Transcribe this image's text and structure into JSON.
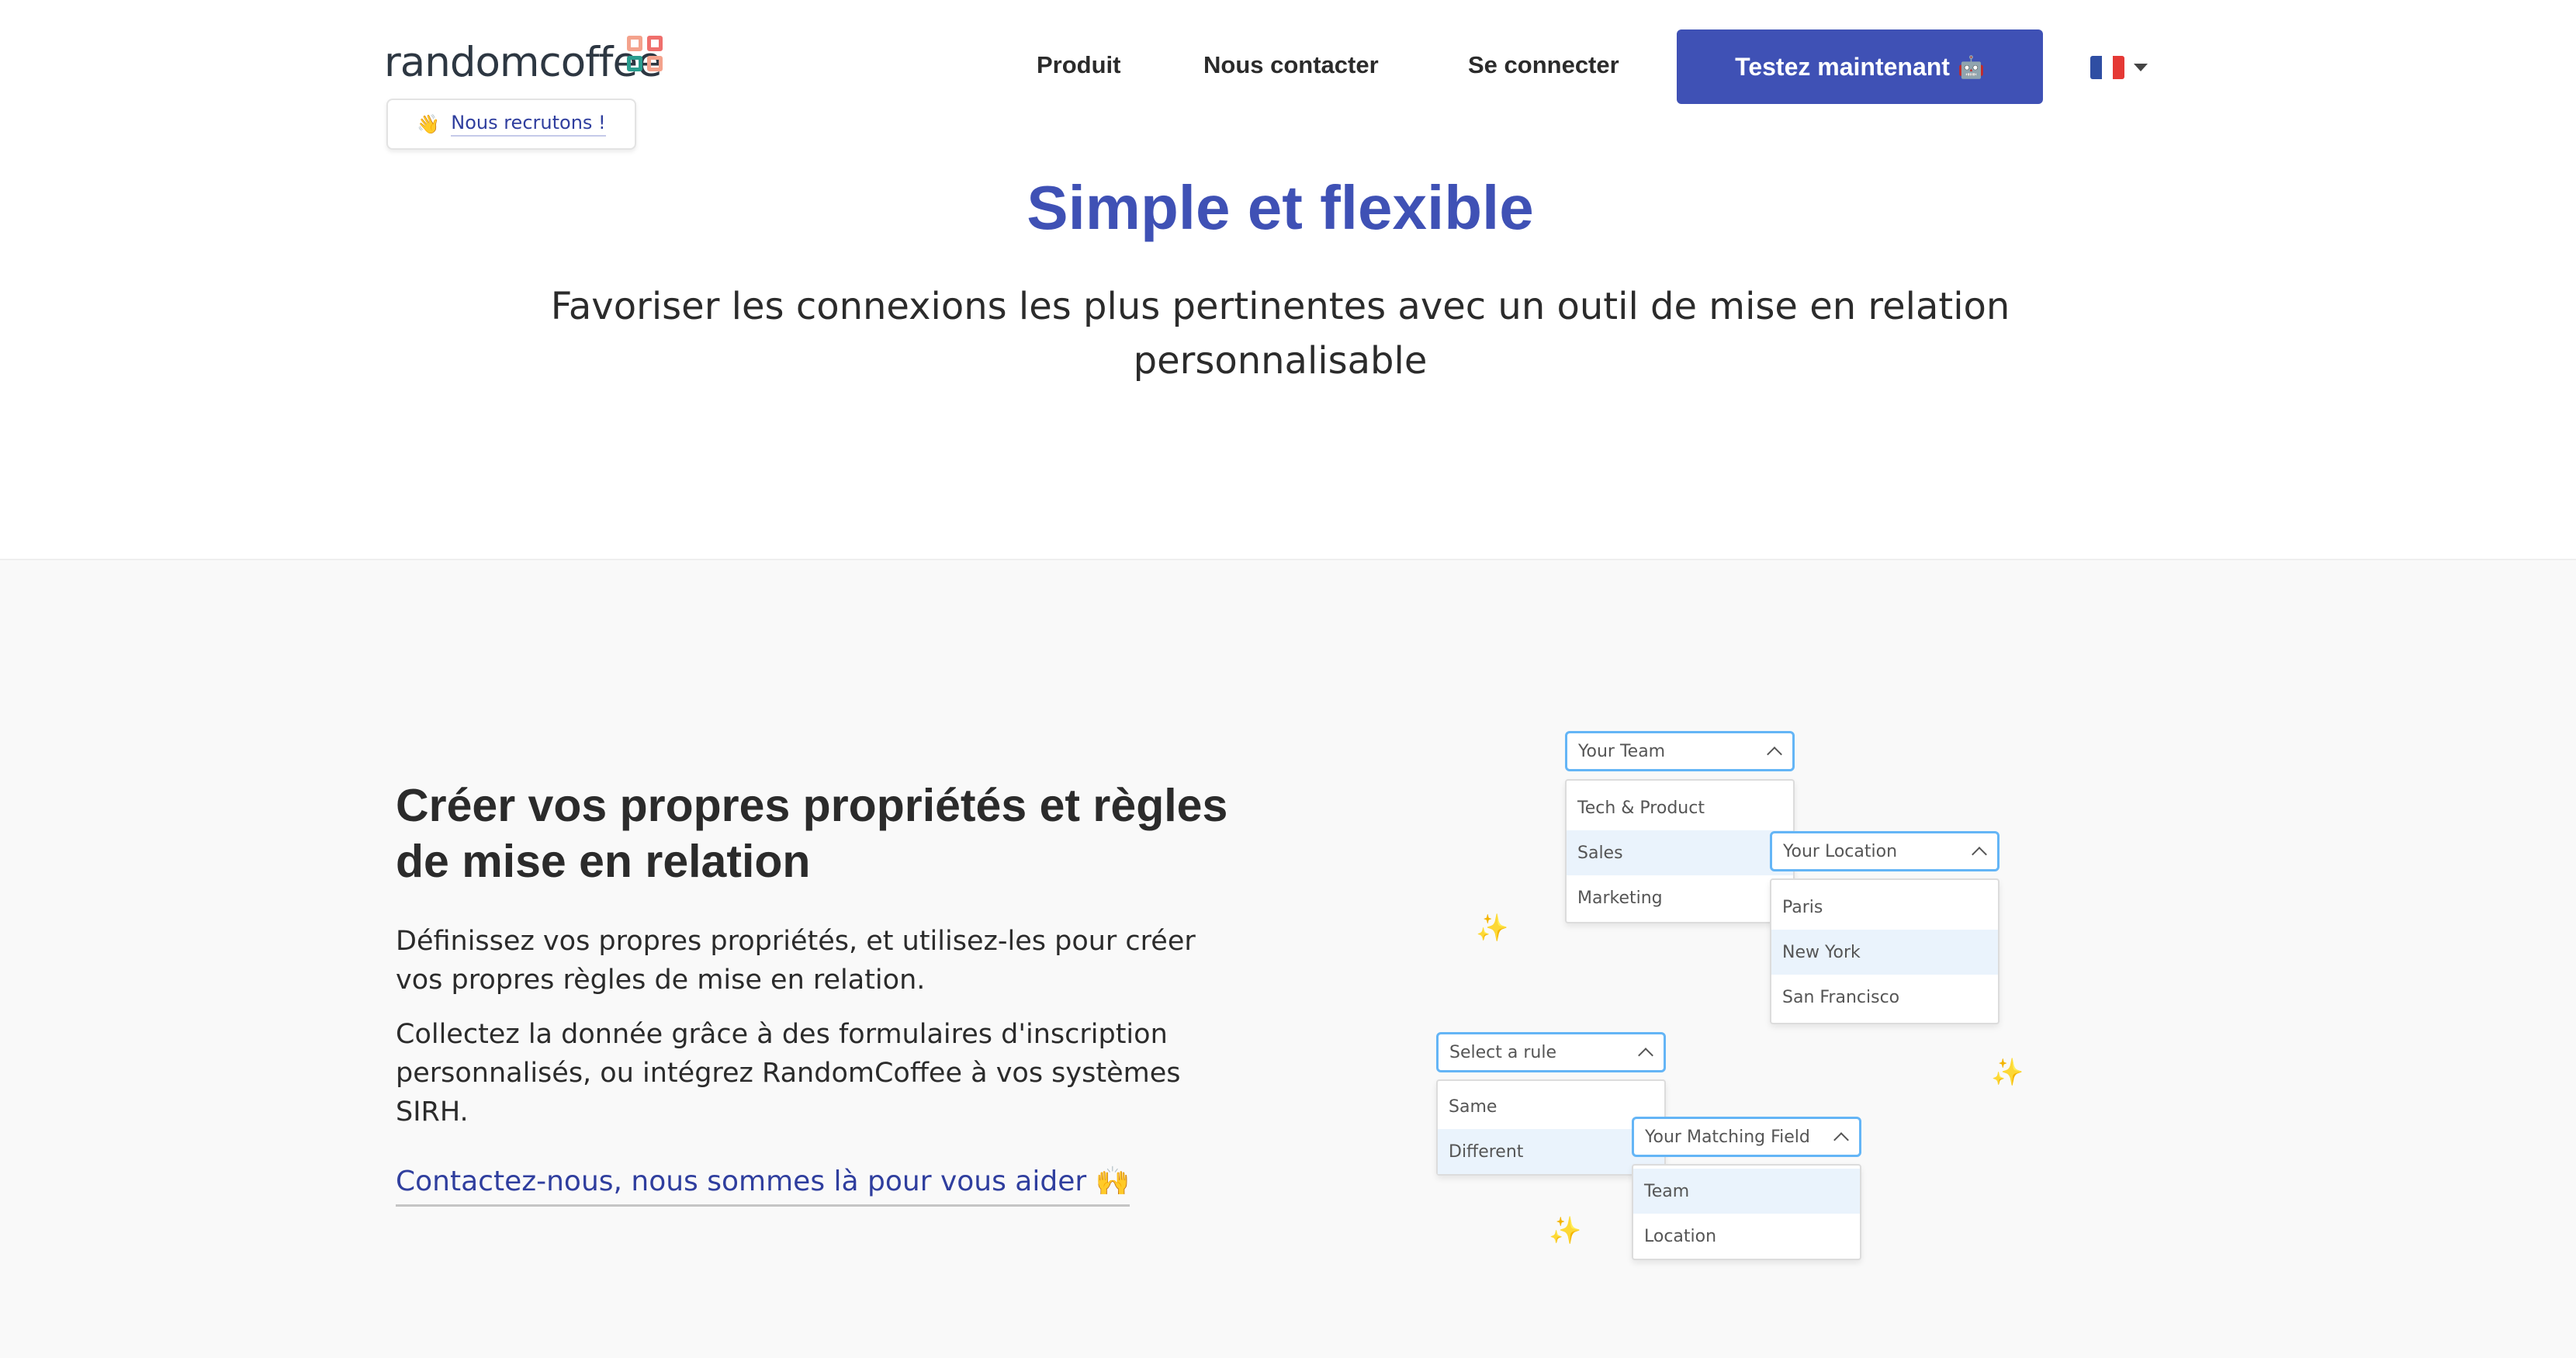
{
  "header": {
    "logo_text": "randomcoffee",
    "recruit_emoji": "👋",
    "recruit_label": "Nous recrutons !",
    "nav": [
      "Produit",
      "Nous contacter",
      "Se connecter"
    ],
    "cta_label": "Testez maintenant",
    "cta_emoji": "🤖",
    "language": "fr"
  },
  "hero": {
    "title": "Simple et flexible",
    "subtitle": "Favoriser les connexions les plus pertinentes avec un outil de mise en relation personnalisable"
  },
  "feature": {
    "title": "Créer vos propres propriétés et règles de mise en relation",
    "p1": "Définissez vos propres propriétés, et utilisez-les pour créer vos propres règles de mise en relation.",
    "p2": "Collectez la donnée grâce à des formulaires d'inscription personnalisés, ou intégrez RandomCoffee à vos systèmes SIRH.",
    "link": "Contactez-nous, nous sommes là pour vous aider 🙌"
  },
  "illustration": {
    "team": {
      "label": "Your Team",
      "options": [
        "Tech & Product",
        "Sales",
        "Marketing"
      ],
      "selected": "Sales"
    },
    "location": {
      "label": "Your Location",
      "options": [
        "Paris",
        "New York",
        "San Francisco"
      ],
      "selected": "New York"
    },
    "rule": {
      "label": "Select a rule",
      "options": [
        "Same",
        "Different"
      ],
      "selected": "Different"
    },
    "matching": {
      "label": "Your Matching Field",
      "options": [
        "Team",
        "Location"
      ],
      "selected": "Team"
    },
    "sparkle": "✨"
  },
  "colors": {
    "brand": "#3f51b5",
    "link": "#2f3e9e",
    "highlight": "#eaf3fc",
    "focus": "#64b5f6"
  }
}
